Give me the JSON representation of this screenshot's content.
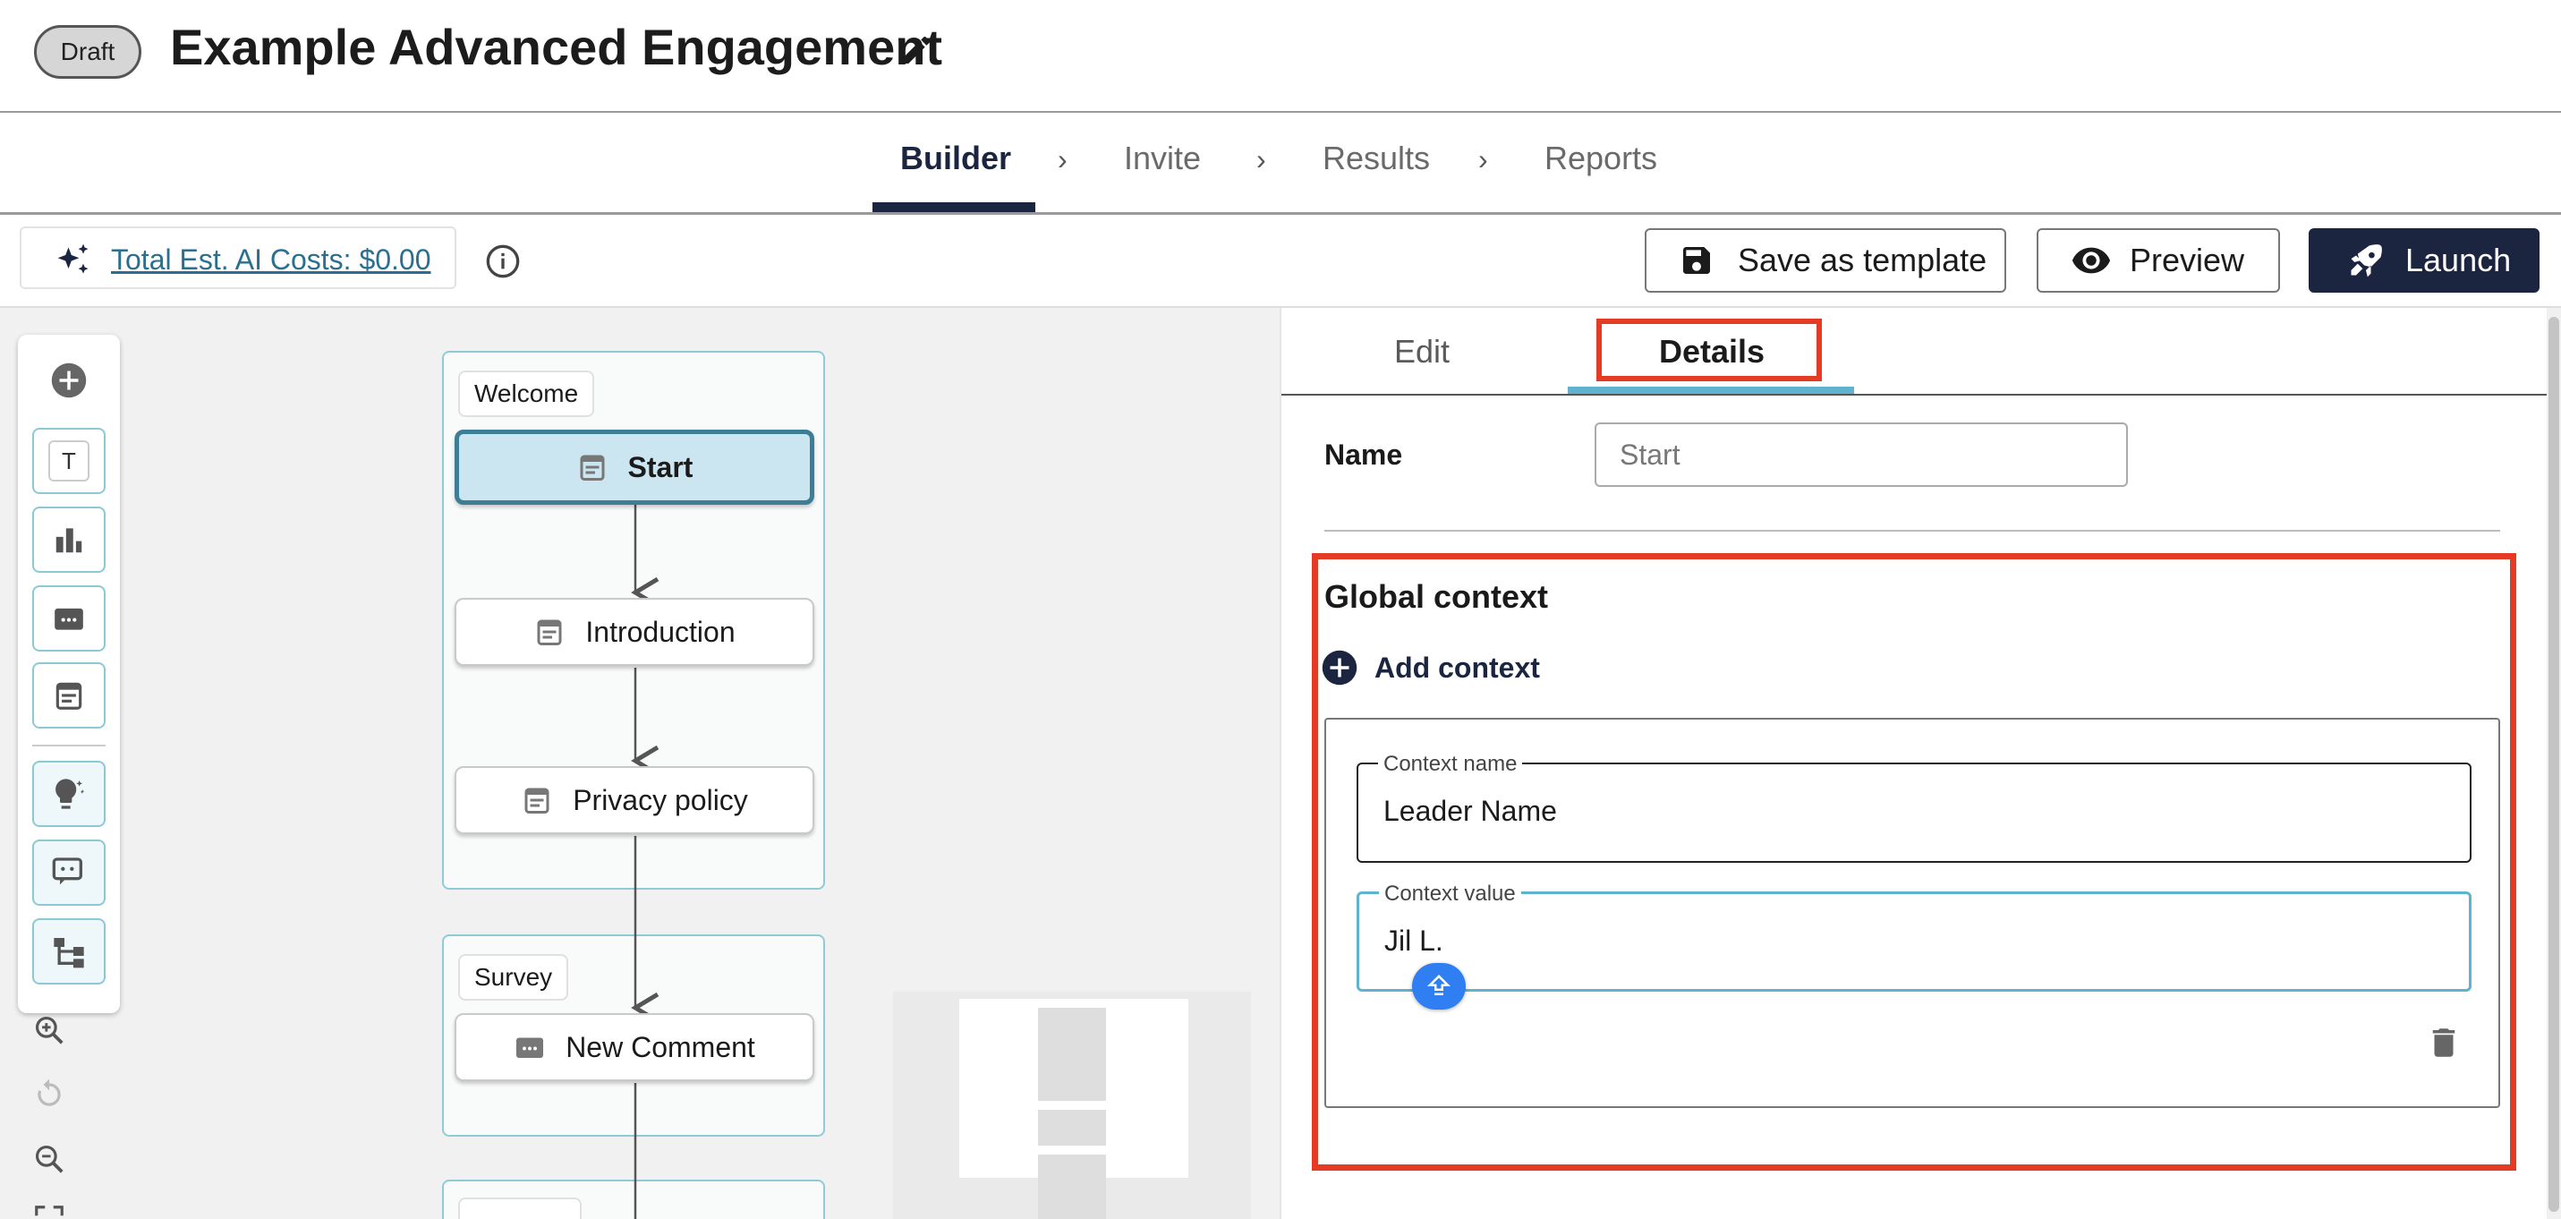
{
  "header": {
    "status_badge": "Draft",
    "title": "Example Advanced Engagement",
    "edit_icon": "pencil-icon"
  },
  "steps": [
    {
      "label": "Builder",
      "active": true
    },
    {
      "label": "Invite",
      "active": false
    },
    {
      "label": "Results",
      "active": false
    },
    {
      "label": "Reports",
      "active": false
    }
  ],
  "toolbar": {
    "ai_cost_label": "Total Est. AI Costs: $0.00",
    "ai_icon": "sparkles-icon",
    "info_icon": "info-icon",
    "save_template_label": "Save as template",
    "preview_label": "Preview",
    "launch_label": "Launch"
  },
  "canvas": {
    "tools": [
      "add-icon",
      "text-icon",
      "bar-chart-icon",
      "comment-icon",
      "form-icon",
      "lightbulb-icon",
      "chat-icon",
      "branch-icon"
    ],
    "text_tool_label": "T",
    "zoom_controls": [
      "zoom-in-icon",
      "reset-icon",
      "zoom-out-icon",
      "fit-icon"
    ],
    "groups": [
      {
        "label": "Welcome"
      },
      {
        "label": "Survey"
      }
    ],
    "nodes": [
      {
        "label": "Start",
        "group": "Welcome",
        "selected": true
      },
      {
        "label": "Introduction",
        "group": "Welcome",
        "selected": false
      },
      {
        "label": "Privacy policy",
        "group": "Welcome",
        "selected": false
      },
      {
        "label": "New Comment",
        "group": "Survey",
        "selected": false
      }
    ]
  },
  "panel": {
    "tabs": [
      {
        "label": "Edit",
        "active": false
      },
      {
        "label": "Details",
        "active": true
      }
    ],
    "name_label": "Name",
    "name_placeholder": "Start",
    "global_context_title": "Global context",
    "add_context_label": "Add context",
    "context": {
      "name_label": "Context name",
      "name_value": "Leader Name",
      "value_label": "Context value",
      "value_value": "Jil L."
    }
  },
  "colors": {
    "brand_dark": "#1b2540",
    "accent_teal": "#5fb3cf",
    "highlight_red": "#e53b24",
    "selected_node_bg": "#cbe6f0"
  }
}
